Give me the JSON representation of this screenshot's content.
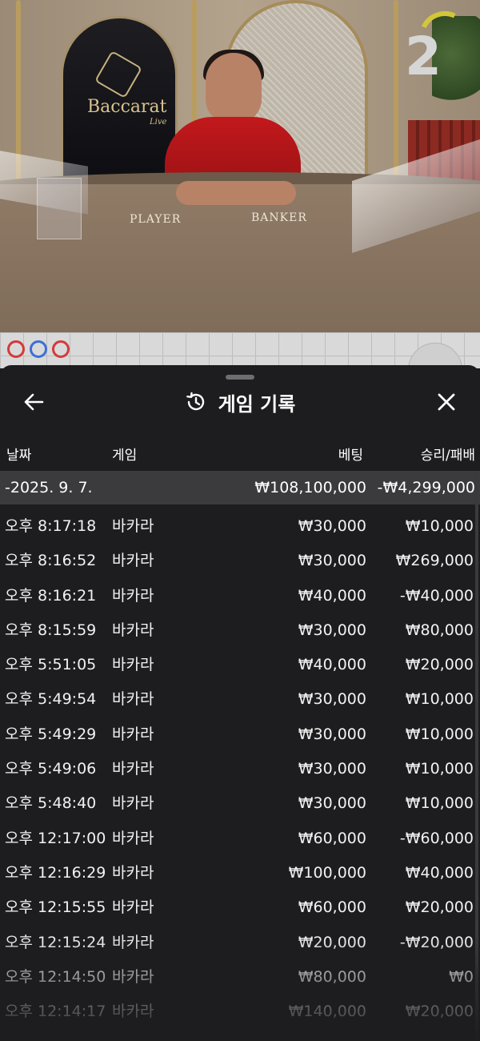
{
  "video": {
    "logo_text": "Baccarat",
    "logo_sub": "Live",
    "label_player": "PLAYER",
    "label_banker": "BANKER",
    "countdown": "2"
  },
  "roadmap": {
    "circles": [
      {
        "color": "#d33a3a"
      },
      {
        "color": "#3d6fd6"
      },
      {
        "color": "#d33a3a"
      }
    ]
  },
  "panel": {
    "title": "게임 기록",
    "headers": {
      "date": "날짜",
      "game": "게임",
      "bet": "베팅",
      "result": "승리/패배"
    },
    "date_group": {
      "date": "-2025. 9. 7.",
      "bet_total": "₩108,100,000",
      "result_total": "-₩4,299,000"
    },
    "rows": [
      {
        "time": "오후 8:17:18",
        "game": "바카라",
        "bet": "₩30,000",
        "result": "₩10,000"
      },
      {
        "time": "오후 8:16:52",
        "game": "바카라",
        "bet": "₩30,000",
        "result": "₩269,000"
      },
      {
        "time": "오후 8:16:21",
        "game": "바카라",
        "bet": "₩40,000",
        "result": "-₩40,000"
      },
      {
        "time": "오후 8:15:59",
        "game": "바카라",
        "bet": "₩30,000",
        "result": "₩80,000"
      },
      {
        "time": "오후 5:51:05",
        "game": "바카라",
        "bet": "₩40,000",
        "result": "₩20,000"
      },
      {
        "time": "오후 5:49:54",
        "game": "바카라",
        "bet": "₩30,000",
        "result": "₩10,000"
      },
      {
        "time": "오후 5:49:29",
        "game": "바카라",
        "bet": "₩30,000",
        "result": "₩10,000"
      },
      {
        "time": "오후 5:49:06",
        "game": "바카라",
        "bet": "₩30,000",
        "result": "₩10,000"
      },
      {
        "time": "오후 5:48:40",
        "game": "바카라",
        "bet": "₩30,000",
        "result": "₩10,000"
      },
      {
        "time": "오후 12:17:00",
        "game": "바카라",
        "bet": "₩60,000",
        "result": "-₩60,000"
      },
      {
        "time": "오후 12:16:29",
        "game": "바카라",
        "bet": "₩100,000",
        "result": "₩40,000"
      },
      {
        "time": "오후 12:15:55",
        "game": "바카라",
        "bet": "₩60,000",
        "result": "₩20,000"
      },
      {
        "time": "오후 12:15:24",
        "game": "바카라",
        "bet": "₩20,000",
        "result": "-₩20,000"
      },
      {
        "time": "오후 12:14:50",
        "game": "바카라",
        "bet": "₩80,000",
        "result": "₩0"
      },
      {
        "time": "오후 12:14:17",
        "game": "바카라",
        "bet": "₩140,000",
        "result": "₩20,000"
      }
    ]
  },
  "icons": {
    "back": "arrow-left-icon",
    "history": "history-icon",
    "close": "close-icon"
  }
}
